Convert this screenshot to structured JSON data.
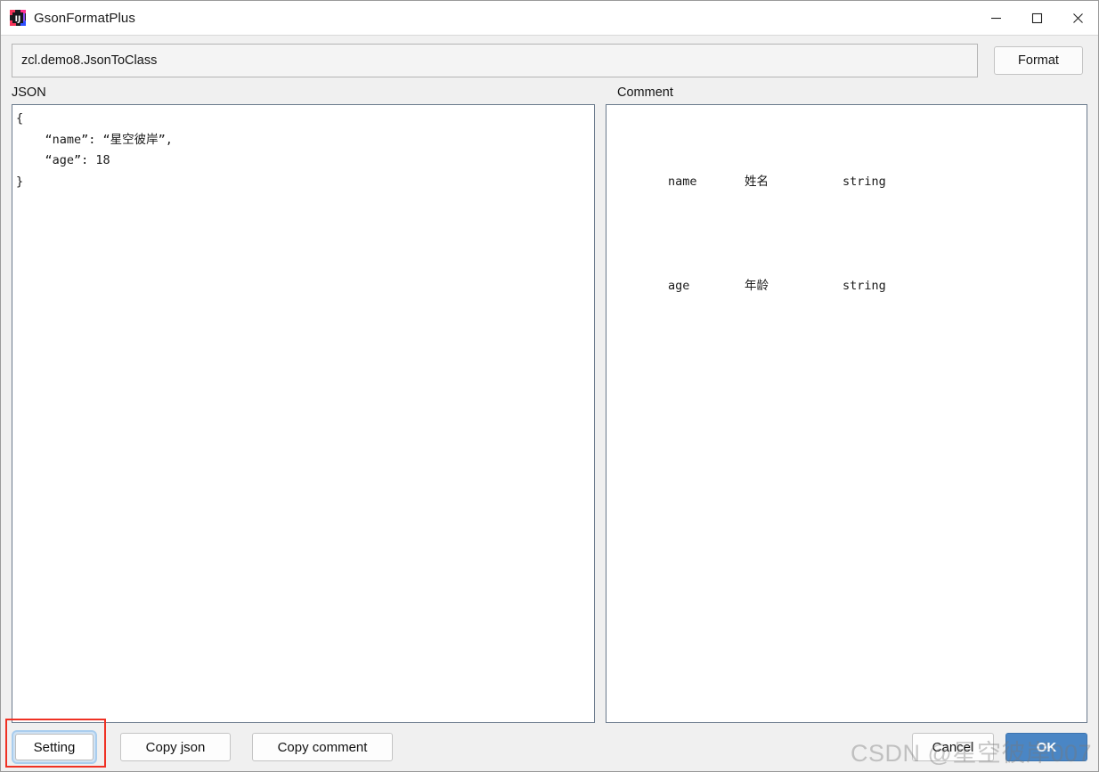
{
  "window": {
    "title": "GsonFormatPlus",
    "app_icon": "intellij-idea-icon",
    "controls": {
      "minimize": "minimize-icon",
      "maximize": "maximize-icon",
      "close": "close-icon"
    }
  },
  "toolbar": {
    "class_path_value": "zcl.demo8.JsonToClass",
    "class_path_placeholder": "",
    "format_label": "Format"
  },
  "panels": {
    "json_label": "JSON",
    "comment_label": "Comment"
  },
  "json_editor": {
    "content": "{\n    “name”: “星空彼岸”,\n    “age”: 18\n}"
  },
  "comment_editor": {
    "rows": [
      {
        "field": "name",
        "chinese": "姓名",
        "type": "string"
      },
      {
        "field": "age",
        "chinese": "年龄",
        "type": "string"
      }
    ]
  },
  "bottom_bar": {
    "setting_label": "Setting",
    "copy_json_label": "Copy json",
    "copy_comment_label": "Copy comment",
    "cancel_label": "Cancel",
    "ok_label": "OK"
  },
  "annotation": {
    "target": "setting-button",
    "color": "#ef3124"
  },
  "watermark": {
    "text": "CSDN @星空彼岸007"
  },
  "colors": {
    "accent_blue": "#4a86c5",
    "focus_ring": "#a9cdee",
    "annotation_red": "#ef3124",
    "panel_border": "#6a7a8c",
    "window_bg": "#f0f0f0"
  }
}
